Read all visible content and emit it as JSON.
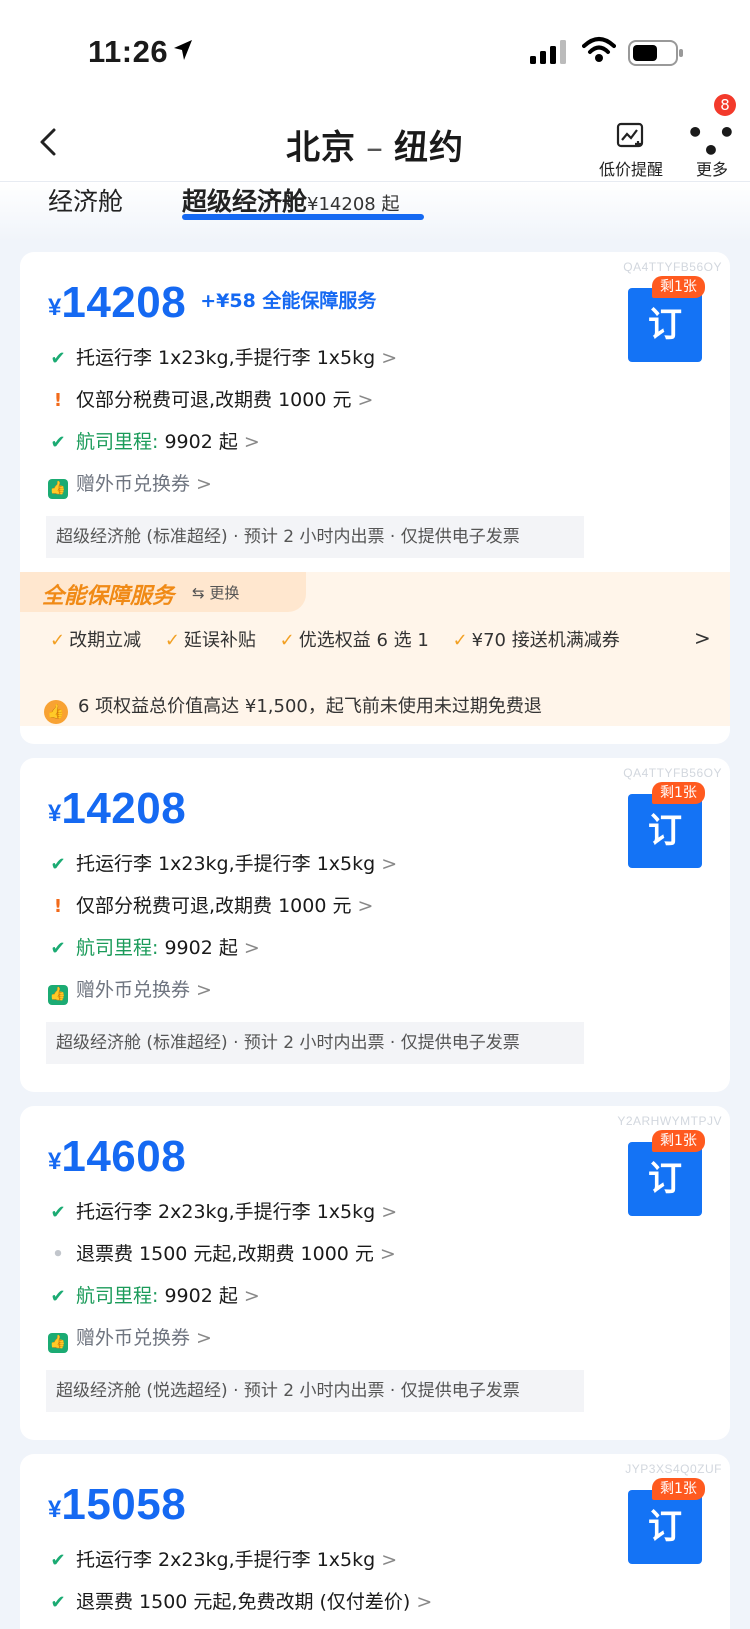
{
  "status": {
    "time": "11:26"
  },
  "nav": {
    "origin": "北京",
    "destination": "纽约",
    "dash": "–",
    "low_price_label": "低价提醒",
    "more_label": "更多",
    "more_badge": "8"
  },
  "tabs": {
    "economy": "经济舱",
    "super_economy": "超级经济舱",
    "super_economy_price": "¥14208 起"
  },
  "cards": [
    {
      "code": "QA4TTYFB56OY",
      "currency": "¥",
      "price": "14208",
      "addon": "+¥58 全能保障服务",
      "remain": "剩1张",
      "book": "订",
      "baggage": "托运行李 1x23kg,手提行李 1x5kg",
      "refund": "仅部分税费可退,改期费 1000 元",
      "miles_label": "航司里程:",
      "miles_value": "9902 起",
      "voucher": "赠外币兑换券",
      "info": "超级经济舱 (标准超经) · 预计 2 小时内出票 · 仅提供电子发票",
      "service_title": "全能保障服务",
      "service_swap": "⇆ 更换",
      "benefits": [
        "改期立减",
        "延误补贴",
        "优选权益 6 选 1",
        "¥70 接送机满减券"
      ],
      "service_note": "6 项权益总价值高达 ¥1,500，起飞前未使用未过期免费退"
    },
    {
      "code": "QA4TTYFB56OY",
      "currency": "¥",
      "price": "14208",
      "remain": "剩1张",
      "book": "订",
      "baggage": "托运行李 1x23kg,手提行李 1x5kg",
      "refund": "仅部分税费可退,改期费 1000 元",
      "miles_label": "航司里程:",
      "miles_value": "9902 起",
      "voucher": "赠外币兑换券",
      "info": "超级经济舱 (标准超经) · 预计 2 小时内出票 · 仅提供电子发票"
    },
    {
      "code": "Y2ARHWYMTPJV",
      "currency": "¥",
      "price": "14608",
      "remain": "剩1张",
      "book": "订",
      "baggage": "托运行李 2x23kg,手提行李 1x5kg",
      "refund": "退票费 1500 元起,改期费 1000 元",
      "miles_label": "航司里程:",
      "miles_value": "9902 起",
      "voucher": "赠外币兑换券",
      "info": "超级经济舱 (悦选超经) · 预计 2 小时内出票 · 仅提供电子发票"
    },
    {
      "code": "JYP3XS4Q0ZUF",
      "currency": "¥",
      "price": "15058",
      "remain": "剩1张",
      "book": "订",
      "baggage": "托运行李 2x23kg,手提行李 1x5kg",
      "refund": "退票费 1500 元起,免费改期 (仅付差价)"
    }
  ]
}
